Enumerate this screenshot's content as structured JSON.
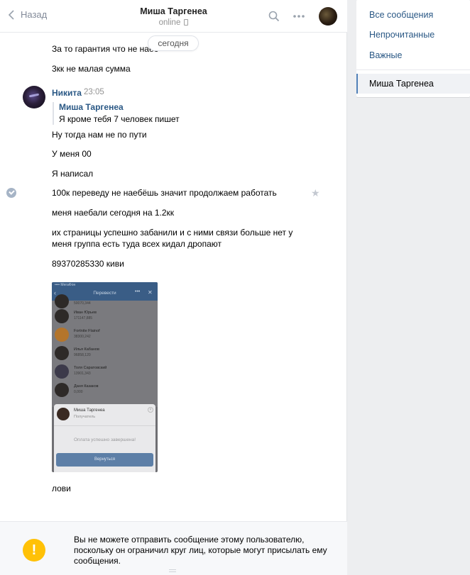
{
  "header": {
    "back_label": "Назад",
    "peer_name": "Миша Таргенеа",
    "peer_status": "online"
  },
  "date_divider": "сегодня",
  "messages_top": [
    "За то гарантия что не наеб",
    "3кк не малая сумма"
  ],
  "sender": {
    "name": "Никита",
    "time": "23:05"
  },
  "forwarded": {
    "name": "Миша Таргенеа",
    "text": "Я кроме тебя 7 человек пишет"
  },
  "messages": [
    "Ну тогда нам не по пути",
    "У меня 00",
    "Я написал",
    "100к переведу не наебёшь значит продолжаем работать",
    "меня наебали сегодня на 1.2кк",
    "их страницы успешно забанили и с ними связи больше нет у",
    "меня группа есть туда всех кидал дропают",
    "89370285330 киви"
  ],
  "attachment": {
    "status_bar": "•••• МегаФон",
    "title": "Перевести",
    "more": "•••",
    "close": "✕",
    "rows": [
      {
        "name": "",
        "balance": "50070,344"
      },
      {
        "name": "Иван Юрьев",
        "balance": "171147,885"
      },
      {
        "name": "Fortnite Flainof",
        "balance": "38300,242"
      },
      {
        "name": "Илья Кабанов",
        "balance": "96858,120"
      },
      {
        "name": "Толя Саратовский",
        "balance": "13901,343"
      },
      {
        "name": "Даня Казаков",
        "balance": "0,000"
      }
    ],
    "sheet_name": "Миша Таргенеа",
    "sheet_role": "Получатель",
    "success": "Оплата успешно завершена!",
    "button": "Вернуться"
  },
  "last_message": "лови",
  "footer": {
    "warning_lines": [
      "Вы не можете отправить сообщение этому пользователю,",
      "поскольку он ограничил круг лиц, которые могут присылать ему",
      "сообщения."
    ]
  },
  "right_menu": {
    "items": [
      "Все сообщения",
      "Непрочитанные",
      "Важные"
    ],
    "active": "Миша Таргенеа"
  },
  "colors": {
    "link": "#2a5885",
    "warning": "#ffc107",
    "accent": "#5181b8"
  }
}
